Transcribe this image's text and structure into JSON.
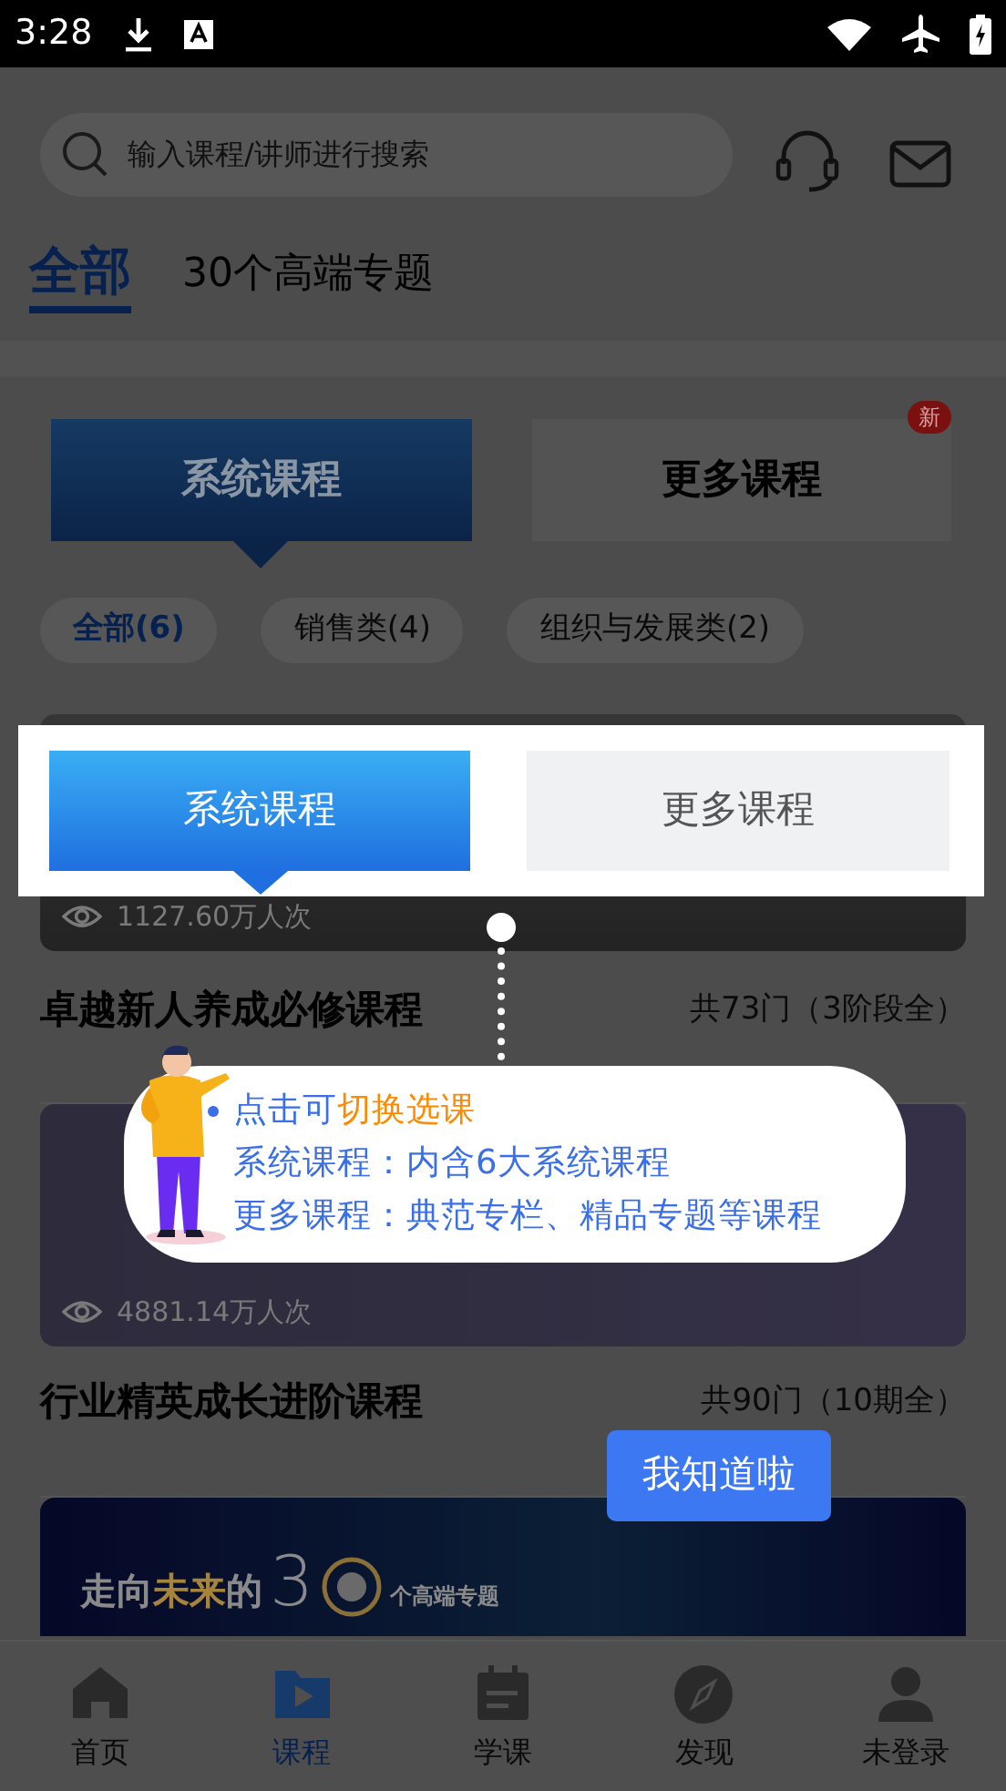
{
  "status_bar": {
    "time": "3:28"
  },
  "search": {
    "placeholder": "输入课程/讲师进行搜索"
  },
  "topic_tabs": [
    {
      "label": "全部",
      "selected": true
    },
    {
      "label": "30个高端专题",
      "selected": false
    }
  ],
  "course_tabs": [
    {
      "label": "系统课程",
      "selected": true
    },
    {
      "label": "更多课程",
      "selected": false,
      "badge": "新"
    }
  ],
  "filters": [
    {
      "label": "全部(6)",
      "selected": true
    },
    {
      "label": "销售类(4)",
      "selected": false
    },
    {
      "label": "组织与发展类(2)",
      "selected": false
    }
  ],
  "courses": [
    {
      "views": "1127.60万人次",
      "title": "卓越新人养成必修课程",
      "count": "共73门（3阶段全）"
    },
    {
      "views": "4881.14万人次",
      "title": "行业精英成长进阶课程",
      "count": "共90门（10期全）"
    }
  ],
  "banner": {
    "title": [
      {
        "text": "走向",
        "accent": false
      },
      {
        "text": "未来",
        "accent": true
      },
      {
        "text": "的",
        "accent": false
      }
    ],
    "numeral": "3",
    "tagline": "个高端专题"
  },
  "bottom_nav": [
    {
      "label": "首页",
      "selected": false
    },
    {
      "label": "课程",
      "selected": true
    },
    {
      "label": "学课",
      "selected": false
    },
    {
      "label": "发现",
      "selected": false
    },
    {
      "label": "未登录",
      "selected": false
    }
  ],
  "guide": {
    "tabs": [
      {
        "label": "系统课程",
        "selected": true
      },
      {
        "label": "更多课程",
        "selected": false
      }
    ],
    "tip_lines": [
      [
        {
          "text": "点击可",
          "accent": false
        },
        {
          "text": "切换选课",
          "accent": true
        }
      ],
      [
        {
          "text": "系统课程：内含6大系统课程",
          "accent": false
        }
      ],
      [
        {
          "text": "更多课程：典范专栏、精品专题等课程",
          "accent": false
        }
      ]
    ],
    "dismiss": "我知道啦"
  }
}
